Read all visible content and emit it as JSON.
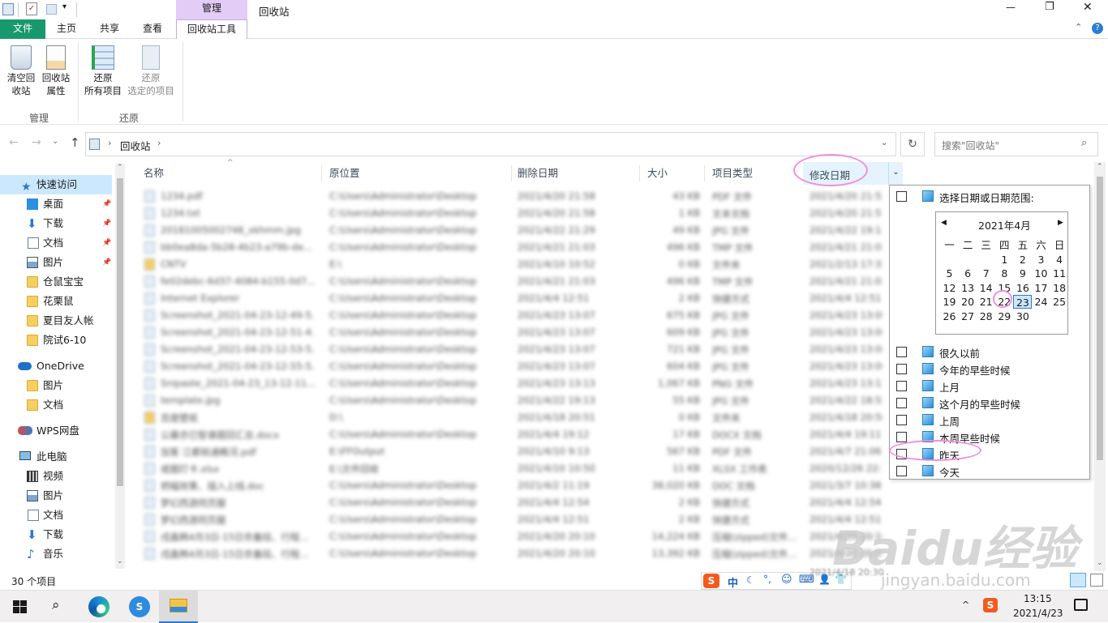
{
  "titlebar": {
    "manage_tab": "管理",
    "window_title": "回收站",
    "minimize": "—",
    "maximize": "❐",
    "close": "✕"
  },
  "ribbon_tabs": {
    "file": "文件",
    "home": "主页",
    "share": "共享",
    "view": "查看",
    "recycle_tools": "回收站工具"
  },
  "ribbon": {
    "empty_bin": "清空回\n收站",
    "bin_props": "回收站\n属性",
    "restore_all": "还原\n所有项目",
    "restore_sel": "还原\n选定的项目",
    "group_manage": "管理",
    "group_restore": "还原"
  },
  "address": {
    "path": "回收站",
    "search_placeholder": "搜索\"回收站\""
  },
  "nav": {
    "quick_access": "快速访问",
    "desktop": "桌面",
    "downloads": "下载",
    "documents": "文档",
    "pictures": "图片",
    "f1": "仓鼠宝宝",
    "f2": "花栗鼠",
    "f3": "夏目友人帐",
    "f4": "院试6-10",
    "onedrive": "OneDrive",
    "od_pics": "图片",
    "od_docs": "文档",
    "wps": "WPS网盘",
    "pc": "此电脑",
    "pc_video": "视频",
    "pc_pics": "图片",
    "pc_docs": "文档",
    "pc_dl": "下载",
    "pc_music": "音乐"
  },
  "columns": {
    "name": "名称",
    "orig": "原位置",
    "deleted": "删除日期",
    "size": "大小",
    "type": "项目类型",
    "modified": "修改日期"
  },
  "files": [
    {
      "n": "1234.pdf",
      "o": "C:\\Users\\Administrator\\Desktop",
      "d": "2021/4/20 21:58",
      "s": "43 KB",
      "t": "PDF 文件",
      "m": "2021/4/20 21:52"
    },
    {
      "n": "1234.txt",
      "o": "C:\\Users\\Administrator\\Desktop",
      "d": "2021/4/20 21:58",
      "s": "1 KB",
      "t": "文本文档",
      "m": "2021/4/20 21:51"
    },
    {
      "n": "20181005002748_xkhmm.jpg",
      "o": "C:\\Users\\Administrator\\Desktop",
      "d": "2021/4/22 21:29",
      "s": "49 KB",
      "t": "JPG 文件",
      "m": "2021/4/22 19:13"
    },
    {
      "n": "bb0ea8da-5b28-4b23-a79b-de...",
      "o": "C:\\Users\\Administrator\\Desktop",
      "d": "2021/4/21 21:03",
      "s": "496 KB",
      "t": "TMP 文件",
      "m": "2021/4/21 21:02"
    },
    {
      "n": "CNTV",
      "o": "E:\\",
      "d": "2021/4/10 10:52",
      "s": "0 KB",
      "t": "文件夹",
      "m": "2021/2/13 17:33"
    },
    {
      "n": "fe02debc-6d37-4084-b155-0d7...",
      "o": "C:\\Users\\Administrator\\Desktop",
      "d": "2021/4/21 21:03",
      "s": "496 KB",
      "t": "TMP 文件",
      "m": "2021/4/21 21:02"
    },
    {
      "n": "Internet  Explorer",
      "o": "C:\\Users\\Administrator\\Desktop",
      "d": "2021/4/4 12:51",
      "s": "2 KB",
      "t": "快捷方式",
      "m": "2021/4/4 12:51"
    },
    {
      "n": "Screenshot_2021-04-23-12-49-5...",
      "o": "C:\\Users\\Administrator\\Desktop",
      "d": "2021/4/23 13:07",
      "s": "675 KB",
      "t": "JPG 文件",
      "m": "2021/4/23 13:06"
    },
    {
      "n": "Screenshot_2021-04-23-12-51-4...",
      "o": "C:\\Users\\Administrator\\Desktop",
      "d": "2021/4/23 13:07",
      "s": "609 KB",
      "t": "JPG 文件",
      "m": "2021/4/23 13:06"
    },
    {
      "n": "Screenshot_2021-04-23-12-53-5...",
      "o": "C:\\Users\\Administrator\\Desktop",
      "d": "2021/4/23 13:07",
      "s": "721 KB",
      "t": "JPG 文件",
      "m": "2021/4/23 13:06"
    },
    {
      "n": "Screenshot_2021-04-23-12-55-5...",
      "o": "C:\\Users\\Administrator\\Desktop",
      "d": "2021/4/23 13:07",
      "s": "604 KB",
      "t": "JPG 文件",
      "m": "2021/4/23 13:06"
    },
    {
      "n": "Snipaste_2021-04-23_13-12-11...",
      "o": "C:\\Users\\Administrator\\Desktop",
      "d": "2021/4/23 13:13",
      "s": "1,067 KB",
      "t": "PNG 文件",
      "m": "2021/4/23 13:12"
    },
    {
      "n": "template.jpg",
      "o": "C:\\Users\\Administrator\\Desktop",
      "d": "2021/4/22 19:13",
      "s": "55 KB",
      "t": "JPG 文件",
      "m": "2021/4/22 18:55"
    },
    {
      "n": "百度壁纸",
      "o": "D:\\",
      "d": "2021/4/18 20:51",
      "s": "0 KB",
      "t": "文件夹",
      "m": "2021/4/18 20:50"
    },
    {
      "n": "公最亦已智谱题回汇总.docx",
      "o": "C:\\Users\\Administrator\\Desktop",
      "d": "2021/4/4 19:12",
      "s": "17 KB",
      "t": "DOCX 文档",
      "m": "2021/4/4 19:11"
    },
    {
      "n": "加客 江都就通概况.pdf",
      "o": "E:\\FFOutput",
      "d": "2021/4/10 9:13",
      "s": "567 KB",
      "t": "PDF 文件",
      "m": "2021/4/7 21:06"
    },
    {
      "n": "戒圈打卡.xlsx",
      "o": "E:\\文件回收",
      "d": "2021/4/10 10:50",
      "s": "11 KB",
      "t": "XLSX 工作表",
      "m": "2020/12/26 22:19"
    },
    {
      "n": "把幅效果、插入上线.doc",
      "o": "C:\\Users\\Administrator\\Desktop",
      "d": "2021/4/2 11:19",
      "s": "38,020 KB",
      "t": "DOC 文档",
      "m": "2021/3/7 10:38"
    },
    {
      "n": "梦幻西游同页服",
      "o": "C:\\Users\\Administrator\\Desktop",
      "d": "2021/4/4 12:54",
      "s": "2 KB",
      "t": "快捷方式",
      "m": "2021/4/4 12:54"
    },
    {
      "n": "梦幻西游同页服",
      "o": "C:\\Users\\Administrator\\Desktop",
      "d": "2021/4/4 12:51",
      "s": "2 KB",
      "t": "快捷方式",
      "m": "2021/4/4 12:51"
    },
    {
      "n": "戌鑫韩4月3日-15日衣番段、行程...",
      "o": "C:\\Users\\Administrator\\Desktop",
      "d": "2021/4/20 20:10",
      "s": "14,224 KB",
      "t": "压缩(zipped)文件...",
      "m": "2021/4/20 20:10"
    },
    {
      "n": "戌鑫韩4月3日-15日衣番段、行程...",
      "o": "C:\\Users\\Administrator\\Desktop",
      "d": "2021/4/20 20:10",
      "s": "13,392 KB",
      "t": "压缩(zipped)文件...",
      "m": "2021/4/20 20:10"
    }
  ],
  "filter": {
    "header": "选择日期或日期范围:",
    "month": "2021年4月",
    "weekdays": [
      "一",
      "二",
      "三",
      "四",
      "五",
      "六",
      "日"
    ],
    "days": [
      "1",
      "2",
      "3",
      "4",
      "5",
      "6",
      "7",
      "8",
      "9",
      "10",
      "11",
      "12",
      "13",
      "14",
      "15",
      "16",
      "17",
      "18",
      "19",
      "20",
      "21",
      "22",
      "23",
      "24",
      "25",
      "26",
      "27",
      "28",
      "29",
      "30"
    ],
    "options": [
      "很久以前",
      "今年的早些时候",
      "上月",
      "这个月的早些时候",
      "上周",
      "本周早些时候",
      "昨天",
      "今天"
    ]
  },
  "status": {
    "count": "30 个项目",
    "modified_partial": "2021/4/18 20:30"
  },
  "taskbar": {
    "ime": "中",
    "time": "13:15",
    "date": "2021/4/23"
  },
  "watermark": {
    "brand": "Baidu经验",
    "url": "jingyan.baidu.com"
  }
}
